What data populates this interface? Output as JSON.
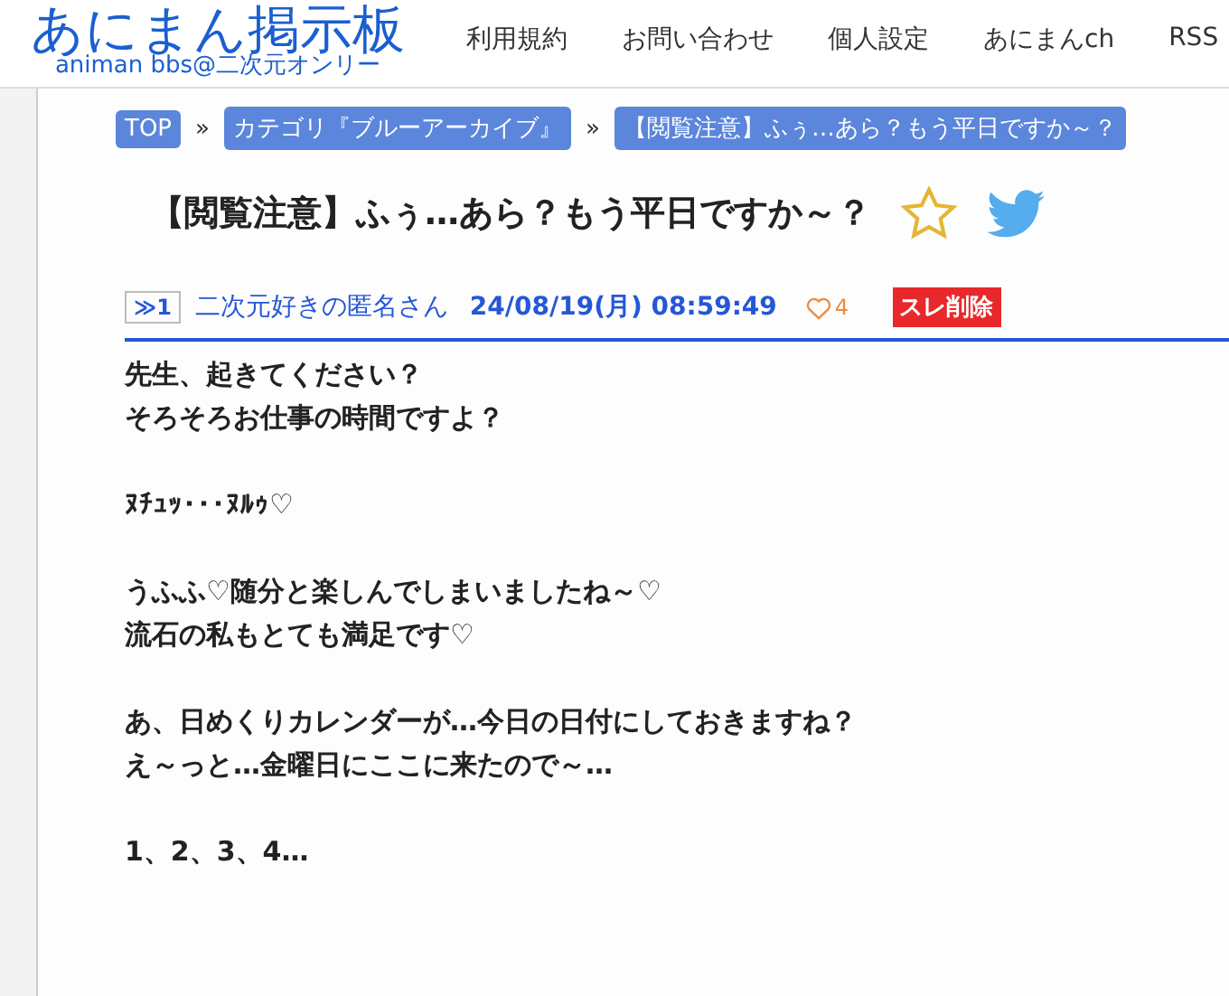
{
  "logo": {
    "title": "あにまん掲示板",
    "subtitle": "animan bbs@二次元オンリー"
  },
  "nav": [
    "利用規約",
    "お問い合わせ",
    "個人設定",
    "あにまんch",
    "RSS"
  ],
  "breadcrumbs": [
    "TOP",
    "カテゴリ『ブルーアーカイブ』",
    "【閲覧注意】ふぅ…あら？もう平日ですか～？"
  ],
  "separator": "»",
  "thread": {
    "title": "【閲覧注意】ふぅ…あら？もう平日ですか～？",
    "favorite": false
  },
  "post": {
    "anchor": "≫1",
    "name": "二次元好きの匿名さん",
    "date": "24/08/19(月) 08:59:49",
    "likes": "4",
    "delete": "スレ削除",
    "paragraphs": [
      {
        "lines": [
          "先生、起きてください？",
          "そろそろお仕事の時間ですよ？"
        ]
      },
      {
        "lines": [
          "ﾇﾁｭｯ･･･ﾇﾙｩ♡"
        ]
      },
      {
        "lines": [
          "うふふ♡随分と楽しんでしまいましたね～♡",
          "流石の私もとても満足です♡"
        ]
      },
      {
        "lines": [
          "あ、日めくりカレンダーが…今日の日付にしておきますね？",
          "え～っと…金曜日にここに来たので～…"
        ]
      },
      {
        "lines": [
          "1、2、3、4…"
        ]
      }
    ]
  }
}
